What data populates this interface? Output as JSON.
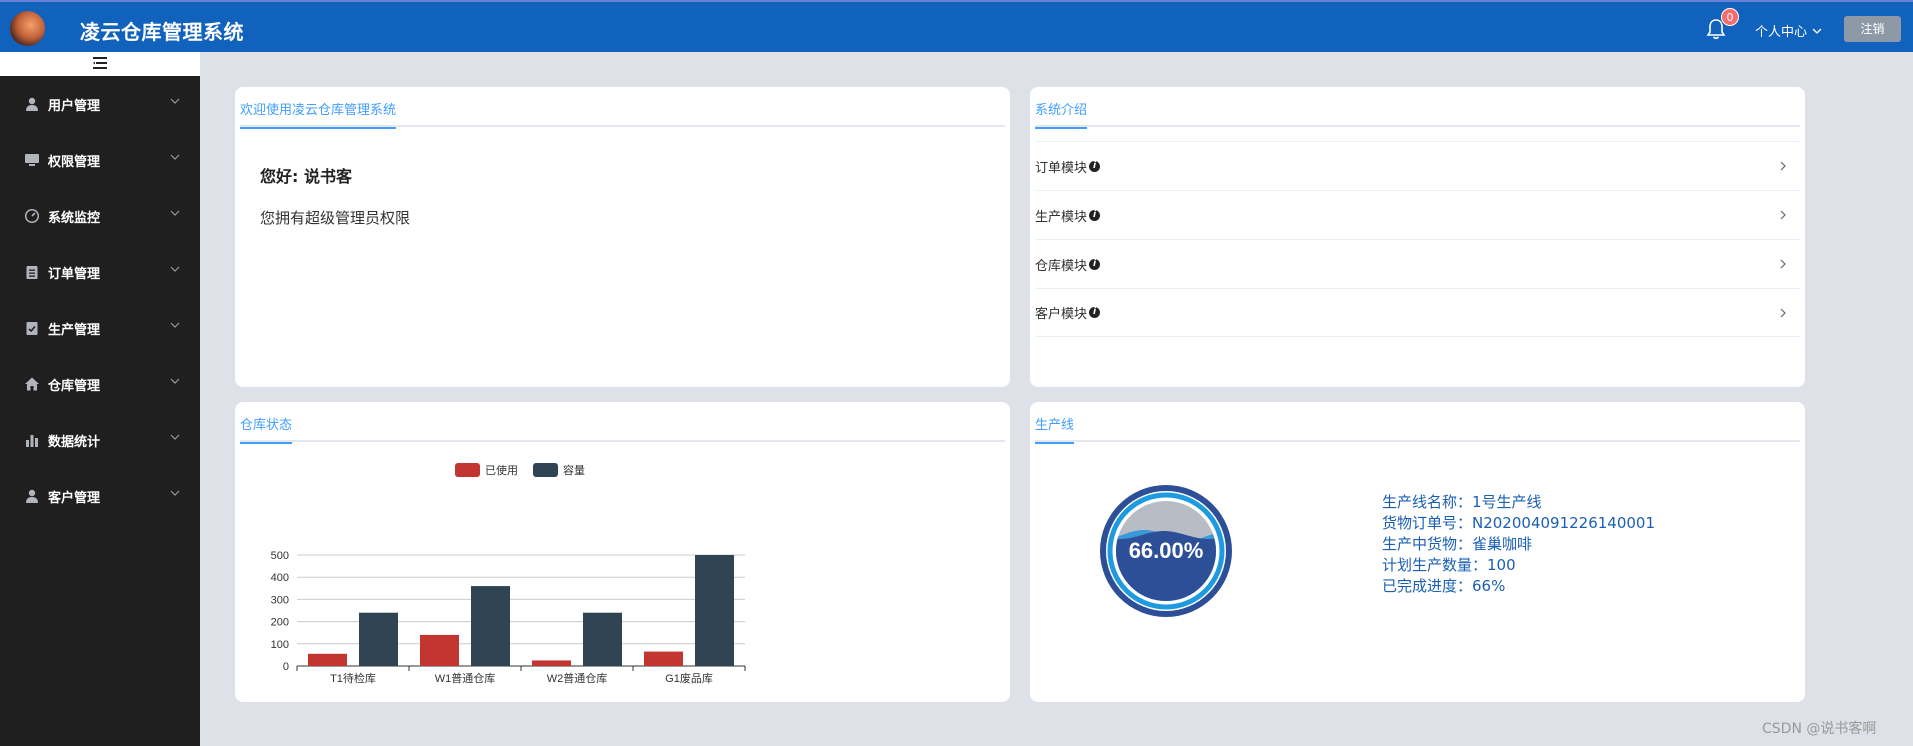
{
  "header": {
    "title": "凌云仓库管理系统",
    "notification_count": "0",
    "user_center_label": "个人中心",
    "logout_label": "注销",
    "colors": {
      "bar": "#1162bd",
      "badge": "#f56c6c"
    }
  },
  "sidebar": {
    "items": [
      {
        "label": "用户管理",
        "icon": "user-icon"
      },
      {
        "label": "权限管理",
        "icon": "monitor-icon"
      },
      {
        "label": "系统监控",
        "icon": "gauge-icon"
      },
      {
        "label": "订单管理",
        "icon": "clipboard-icon"
      },
      {
        "label": "生产管理",
        "icon": "clipboard-check-icon"
      },
      {
        "label": "仓库管理",
        "icon": "home-icon"
      },
      {
        "label": "数据统计",
        "icon": "bar-chart-icon"
      },
      {
        "label": "客户管理",
        "icon": "customer-icon"
      }
    ]
  },
  "welcome": {
    "tab": "欢迎使用凌云仓库管理系统",
    "greeting": "您好: 说书客",
    "permission": "您拥有超级管理员权限"
  },
  "intro": {
    "tab": "系统介绍",
    "items": [
      "订单模块",
      "生产模块",
      "仓库模块",
      "客户模块"
    ]
  },
  "warehouse": {
    "tab": "仓库状态"
  },
  "production": {
    "tab": "生产线",
    "gauge_label": "66.00%",
    "gauge_value": 0.66,
    "lines": [
      "生产线名称：1号生产线",
      "货物订单号：N202004091226140001",
      "生产中货物：雀巢咖啡",
      "计划生产数量：100",
      "已完成进度：66%"
    ]
  },
  "watermark": "CSDN @说书客啊",
  "chart_data": {
    "type": "bar",
    "categories": [
      "T1待检库",
      "W1普通仓库",
      "W2普通仓库",
      "G1废品库"
    ],
    "series": [
      {
        "name": "已使用",
        "values": [
          55,
          140,
          25,
          65
        ],
        "color": "#c23531"
      },
      {
        "name": "容量",
        "values": [
          240,
          360,
          240,
          500
        ],
        "color": "#2f4554"
      }
    ],
    "yticks": [
      0,
      100,
      200,
      300,
      400,
      500
    ],
    "ylim": [
      0,
      500
    ],
    "grid": true,
    "legend_position": "top"
  }
}
